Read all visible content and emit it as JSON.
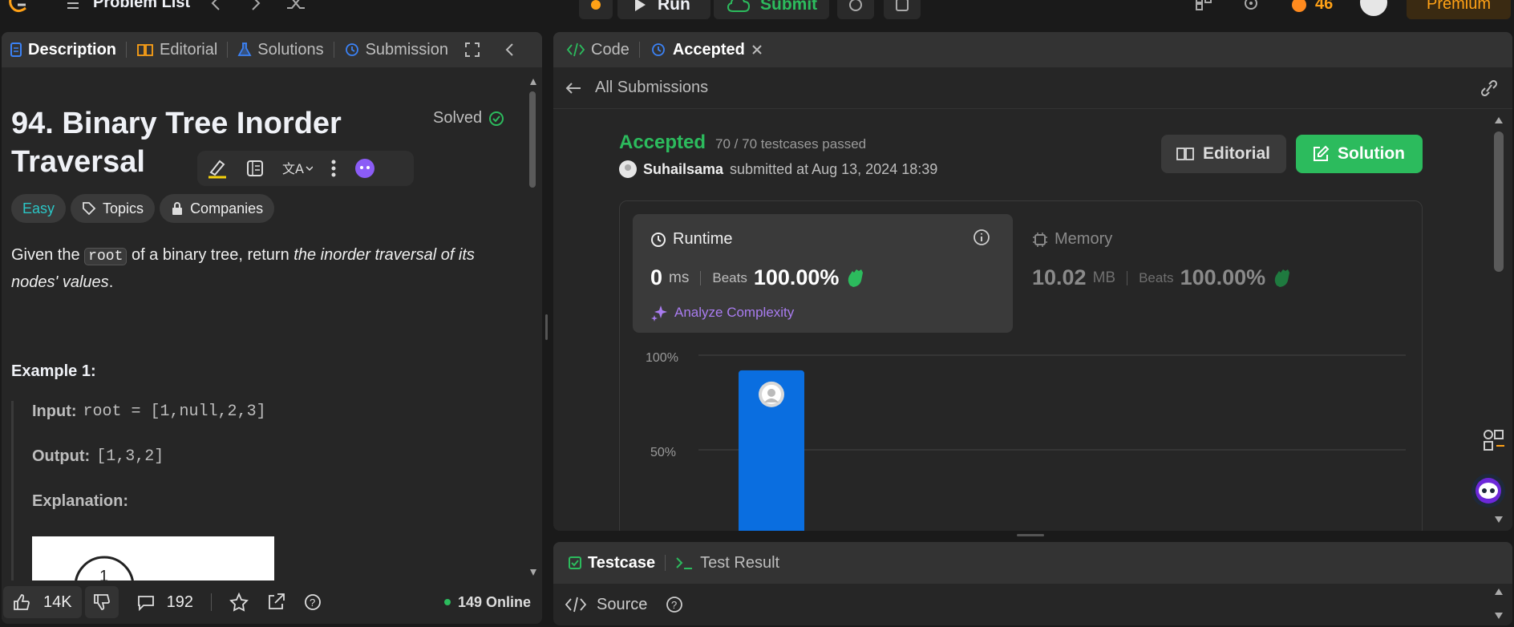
{
  "topbar": {
    "problem_list": "Problem List",
    "run": "Run",
    "submit": "Submit",
    "streak": "46",
    "premium": "Premium"
  },
  "left": {
    "tabs": [
      "Description",
      "Editorial",
      "Solutions",
      "Submission"
    ],
    "title_line1": "94. Binary Tree Inorder",
    "title_line2": "Traversal",
    "solved": "Solved",
    "difficulty": "Easy",
    "topics": "Topics",
    "companies": "Companies",
    "desc_p1": "Given the ",
    "desc_code": "root",
    "desc_p2": " of a binary tree, return ",
    "desc_em1": "the inorder traversal of its",
    "desc_em2": "nodes' values",
    "desc_end": ".",
    "example_title": "Example 1:",
    "input_label": "Input:",
    "input_value": "root = [1,null,2,3]",
    "output_label": "Output:",
    "output_value": "[1,3,2]",
    "explanation_label": "Explanation:",
    "likes": "14K",
    "comments": "192",
    "online": "149 Online"
  },
  "right": {
    "tabs": [
      "Code",
      "Accepted"
    ],
    "back_label": "All Submissions",
    "status": "Accepted",
    "testcases": "70 / 70 testcases passed",
    "username": "Suhailsama",
    "submitted_at": "submitted at Aug 13, 2024 18:39",
    "editorial_btn": "Editorial",
    "solution_btn": "Solution",
    "runtime_label": "Runtime",
    "runtime_value": "0",
    "runtime_unit": "ms",
    "beats_label": "Beats",
    "runtime_beats": "100.00%",
    "analyze": "Analyze Complexity",
    "memory_label": "Memory",
    "memory_value": "10.02",
    "memory_unit": "MB",
    "memory_beats": "100.00%",
    "colors": {
      "accent_green": "#2cbb5d",
      "bar_blue": "#0a6ee0",
      "analyze_purple": "#a97cf0"
    }
  },
  "bottom": {
    "tabs": [
      "Testcase",
      "Test Result"
    ],
    "source": "Source"
  },
  "chart_data": {
    "type": "bar",
    "yticks": [
      "100%",
      "50%"
    ],
    "ylim": [
      0,
      100
    ],
    "series": [
      {
        "values": [
          92
        ]
      }
    ]
  }
}
